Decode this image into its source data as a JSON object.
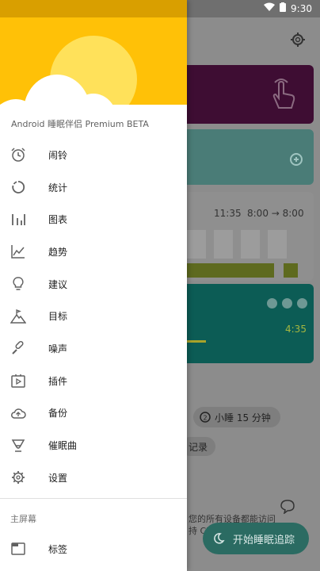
{
  "status_bar": {
    "time": "9:30",
    "wifi_icon": "wifi-icon",
    "battery_icon": "battery-icon"
  },
  "drawer": {
    "app_name": "Android 睡眠伴侣 Premium BETA",
    "items": [
      {
        "label": "闹铃",
        "icon": "alarm-clock-icon"
      },
      {
        "label": "统计",
        "icon": "circle-stats-icon"
      },
      {
        "label": "图表",
        "icon": "bar-chart-icon"
      },
      {
        "label": "趋势",
        "icon": "trend-line-icon"
      },
      {
        "label": "建议",
        "icon": "lightbulb-icon"
      },
      {
        "label": "目标",
        "icon": "mountain-flag-icon"
      },
      {
        "label": "噪声",
        "icon": "microphone-icon"
      },
      {
        "label": "插件",
        "icon": "plugin-icon"
      },
      {
        "label": "备份",
        "icon": "cloud-upload-icon"
      },
      {
        "label": "催眠曲",
        "icon": "lullaby-icon"
      },
      {
        "label": "设置",
        "icon": "settings-icon"
      }
    ],
    "section_title": "主屏幕",
    "bottom_items": [
      {
        "label": "标签",
        "icon": "tag-window-icon"
      }
    ],
    "colors": {
      "header": "#ffc107",
      "sun": "#ffe15a",
      "cloud": "#ffffff"
    }
  },
  "background": {
    "chart_times": {
      "now": "11:35",
      "range": "8:00 → 8:00"
    },
    "track_time": "4:35",
    "nap_label": "小睡 15 分钟",
    "record_label": "记录",
    "bottom_text_1": "您的所有设备都能访问",
    "bottom_text_2": "持 Cloud",
    "start_button": "开始睡眠追踪"
  }
}
